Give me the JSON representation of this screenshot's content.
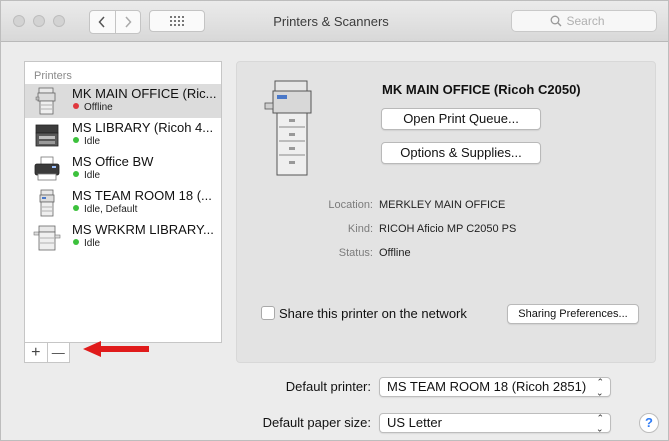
{
  "window": {
    "title": "Printers & Scanners",
    "search_placeholder": "Search"
  },
  "printers": {
    "header": "Printers",
    "items": [
      {
        "name": "MK MAIN OFFICE (Ric...",
        "status": "Offline",
        "status_color": "#e0383e",
        "selected": true,
        "icon": "printer-copier-icon"
      },
      {
        "name": "MS LIBRARY (Ricoh 4...",
        "status": "Idle",
        "status_color": "#3cc13c",
        "selected": false,
        "icon": "printer-laser-icon"
      },
      {
        "name": "MS Office BW",
        "status": "Idle",
        "status_color": "#3cc13c",
        "selected": false,
        "icon": "printer-inkjet-icon"
      },
      {
        "name": "MS TEAM ROOM 18 (...",
        "status": "Idle, Default",
        "status_color": "#3cc13c",
        "selected": false,
        "icon": "printer-copier-icon"
      },
      {
        "name": "MS WRKRM LIBRARY...",
        "status": "Idle",
        "status_color": "#3cc13c",
        "selected": false,
        "icon": "printer-copier-wide-icon"
      }
    ],
    "add_label": "+",
    "remove_label": "—"
  },
  "detail": {
    "title": "MK MAIN OFFICE (Ricoh C2050)",
    "open_queue_label": "Open Print Queue...",
    "options_label": "Options & Supplies...",
    "location_label": "Location:",
    "location_value": "MERKLEY MAIN OFFICE",
    "kind_label": "Kind:",
    "kind_value": "RICOH Aficio MP C2050 PS",
    "status_label": "Status:",
    "status_value": "Offline",
    "share_label": "Share this printer on the network",
    "sharing_prefs_label": "Sharing Preferences..."
  },
  "bottom": {
    "default_printer_label": "Default printer:",
    "default_printer_value": "MS TEAM ROOM 18 (Ricoh 2851)",
    "paper_size_label": "Default paper size:",
    "paper_size_value": "US Letter",
    "help_label": "?"
  },
  "annotation": {
    "arrow_color": "#e01b1b"
  }
}
